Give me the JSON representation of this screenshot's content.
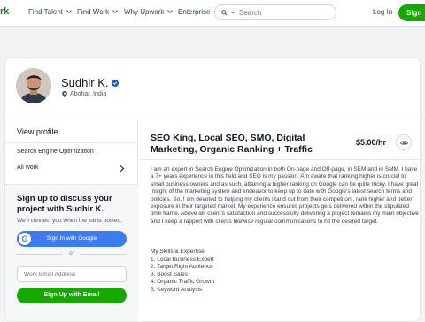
{
  "nav": {
    "brand": "rk",
    "links": [
      "Find Talent",
      "Find Work",
      "Why Upwork",
      "Enterprise"
    ],
    "search_placeholder": "Search",
    "login": "Log In",
    "signup": "Sign"
  },
  "profile": {
    "name": "Sudhir K.",
    "location": "Abohar, India"
  },
  "left": {
    "view_profile": "View profile",
    "specialization": "Search Engine Optimization",
    "all_work": "All work",
    "signup_title": "Sign up to discuss your project with Sudhir K.",
    "signup_sub": "We'll connect you when the job is posted.",
    "google_btn": "Sign In with Google",
    "or": "or",
    "email_placeholder": "Work Email Address",
    "signup_email_btn": "Sign Up with Email"
  },
  "main": {
    "title": "SEO King, Local SEO, SMO, Digital Marketing, Organic Ranking + Traffic",
    "rate": "$5.00/hr",
    "description": "I am an expert in Search Engine Optimization in both On-page and Off-page, in SEM and in SMM. I have a 7+ years experience in this field and SEO is my passion. Am aware that ranking higher is crucial to small business owners and as such, attaining a higher ranking on Google can be quite tricky. I have great insight of the marketing system and endeavor to keep up to date with Google's latest search terms and policies. So, I am devoted to helping my clients stand out from their competitors, rank higher and better exposure in their targeted market. My experience ensures projects gets delivered within the stipulated time frame. Above all, client's satisfaction and successfully delivering a project remains my main objective and I keep a rapport with clients likewise regular communications to hit the desired target.",
    "skills_title": "My Skills & Expertise:",
    "skills": [
      "1. Local Business Expert",
      "2. Target Right Audience",
      "3. Boost Sales",
      "4. Organic Traffic Growth",
      "5. Keyword Analysis"
    ]
  },
  "colors": {
    "brand_green": "#14a800",
    "google_blue": "#3d7bf0",
    "verified_blue": "#1f57c3"
  }
}
